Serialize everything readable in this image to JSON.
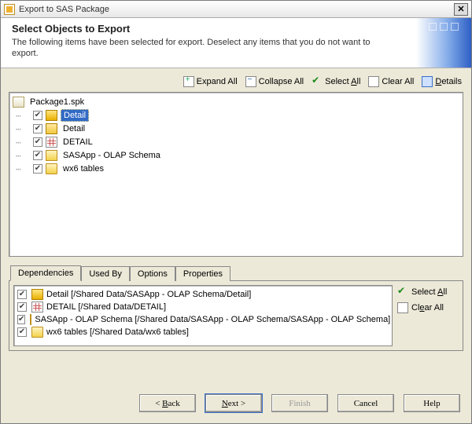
{
  "window": {
    "title": "Export to SAS Package"
  },
  "header": {
    "title": "Select Objects to Export",
    "desc": "The following items have been selected for export.  Deselect any items that you do not want to export."
  },
  "toolbar": {
    "expand": "Expand All",
    "collapse": "Collapse All",
    "selectall_pre": "Select ",
    "selectall_u": "A",
    "selectall_post": "ll",
    "clearall": "Clear All",
    "details_u": "D",
    "details_post": "etails"
  },
  "tree": {
    "root": {
      "label": "Package1.spk",
      "icon": "pkg"
    },
    "items": [
      {
        "label": "Detail",
        "icon": "cube",
        "checked": true,
        "selected": true
      },
      {
        "label": "Detail",
        "icon": "cube2",
        "checked": true
      },
      {
        "label": "DETAIL",
        "icon": "grid",
        "checked": true
      },
      {
        "label": "SASApp - OLAP Schema",
        "icon": "schema",
        "checked": true
      },
      {
        "label": "wx6 tables",
        "icon": "folder",
        "checked": true
      }
    ]
  },
  "tabs": {
    "items": [
      {
        "label": "Dependencies",
        "active": true
      },
      {
        "label": "Used By"
      },
      {
        "label": "Options"
      },
      {
        "label": "Properties"
      }
    ]
  },
  "deps": {
    "items": [
      {
        "label": "Detail  [/Shared Data/SASApp - OLAP Schema/Detail]",
        "icon": "cube",
        "checked": true
      },
      {
        "label": "DETAIL  [/Shared Data/DETAIL]",
        "icon": "grid",
        "checked": true
      },
      {
        "label": "SASApp - OLAP Schema  [/Shared Data/SASApp - OLAP Schema/SASApp - OLAP Schema]",
        "icon": "schema",
        "checked": true
      },
      {
        "label": "wx6 tables  [/Shared Data/wx6 tables]",
        "icon": "folder",
        "checked": true
      }
    ],
    "selectall_pre": "Select ",
    "selectall_u": "A",
    "selectall_post": "ll",
    "clearall_pre": "Cl",
    "clearall_u": "e",
    "clearall_post": "ar All"
  },
  "footer": {
    "back_pre": "< ",
    "back_u": "B",
    "back_post": "ack",
    "next_u": "N",
    "next_post": "ext >",
    "finish": "Finish",
    "cancel": "Cancel",
    "help": "Help"
  }
}
